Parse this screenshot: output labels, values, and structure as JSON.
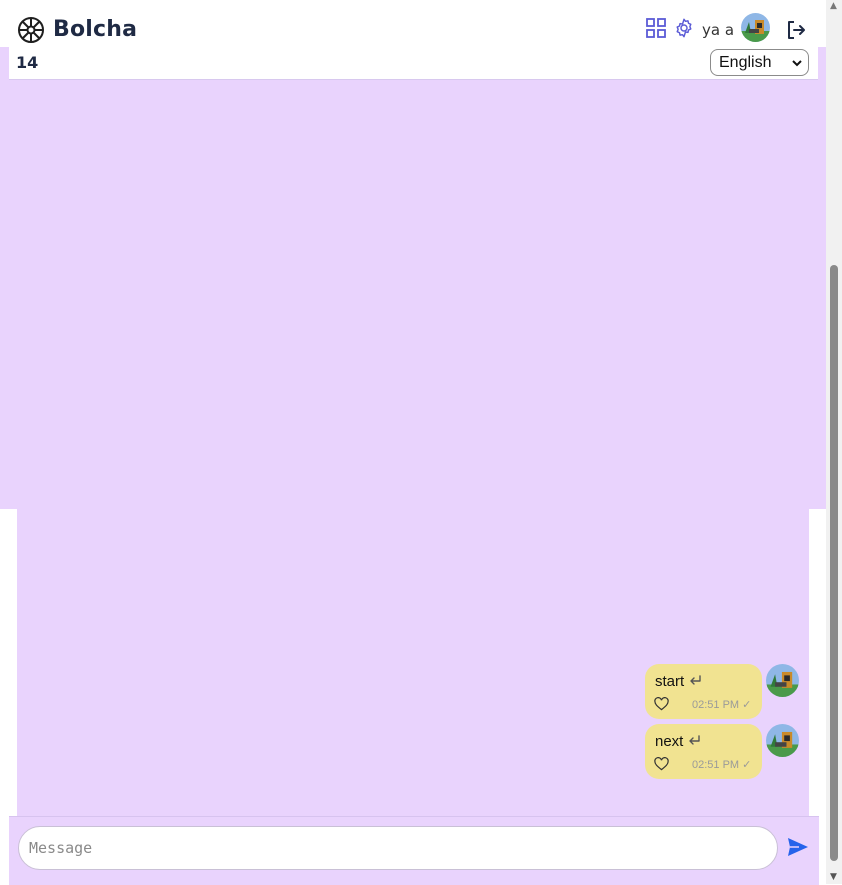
{
  "app": {
    "title": "Bolcha"
  },
  "header": {
    "user_name": "ya a",
    "icons": {
      "grid": "grid-icon",
      "settings": "gear-icon",
      "logout": "logout-icon"
    }
  },
  "subbar": {
    "count": "14",
    "language": {
      "selected": "English"
    }
  },
  "composer": {
    "placeholder": "Message",
    "send": "send-icon"
  },
  "messages": [
    {
      "text": "start",
      "time": "02:51 PM",
      "status": "✓"
    },
    {
      "text": "next",
      "time": "02:51 PM",
      "status": "✓"
    }
  ],
  "colors": {
    "chat_bg": "#e9d3fd",
    "bubble": "#f1e391",
    "accent": "#2563eb",
    "icon_purple": "#5b5bd6"
  }
}
